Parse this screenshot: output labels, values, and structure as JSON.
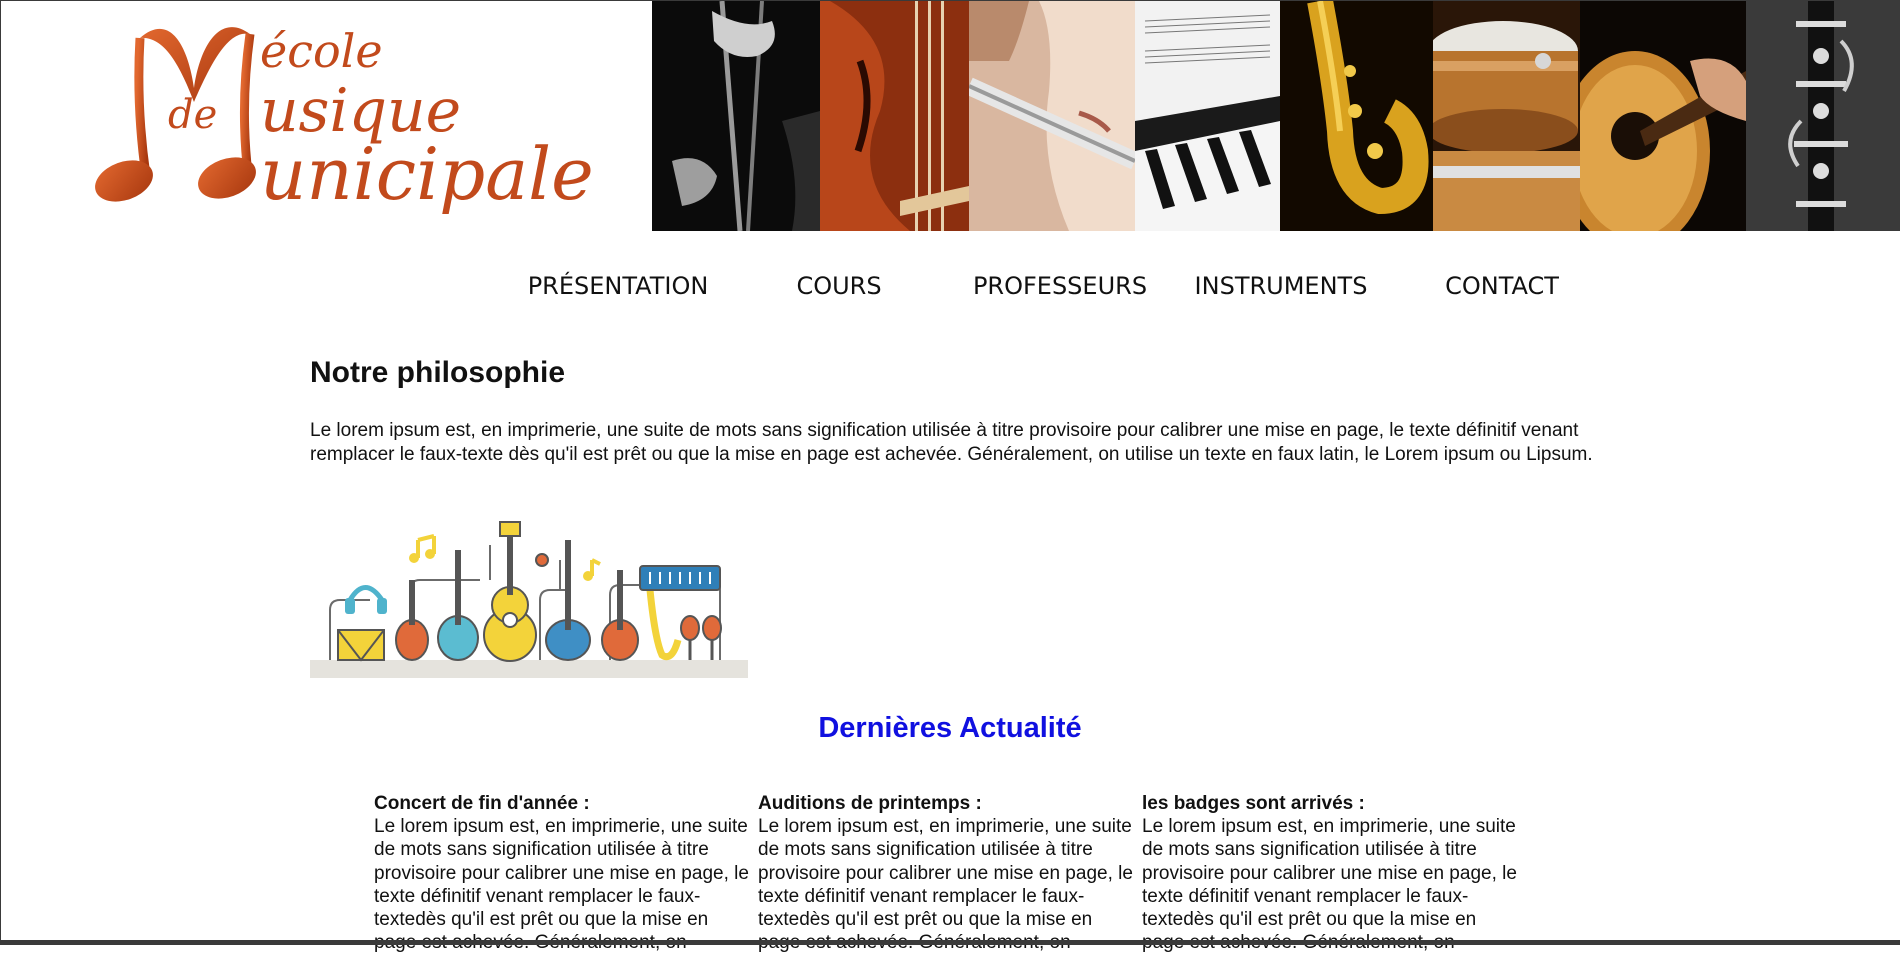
{
  "header": {
    "logo": {
      "word_ecole": "école",
      "word_de": "de",
      "word_usique": "usique",
      "word_unicipale": "unicipale",
      "accent_color": "#c24a1c"
    },
    "banner_photos": [
      "drumsticks",
      "violin",
      "flute",
      "piano",
      "saxophone",
      "drum-kit",
      "guitar",
      "clarinet"
    ]
  },
  "nav": {
    "items": [
      {
        "label": "PRÉSENTATION"
      },
      {
        "label": "COURS"
      },
      {
        "label": "PROFESSEURS"
      },
      {
        "label": "INSTRUMENTS"
      },
      {
        "label": "CONTACT"
      }
    ]
  },
  "main": {
    "title": "Notre philosophie",
    "intro": "Le lorem ipsum est, en imprimerie, une suite de mots sans signification utilisée à titre provisoire pour calibrer une mise en page, le texte définitif venant remplacer le faux-texte dès qu'il est prêt ou que la mise en page est achevée. Généralement, on utilise un texte en faux latin, le Lorem ipsum ou Lipsum.",
    "illustration": "music-instruments-illustration"
  },
  "news": {
    "title": "Dernières Actualité",
    "title_color": "#1010e0",
    "items": [
      {
        "heading": "Concert de fin d'année :",
        "body": "Le lorem ipsum est, en imprimerie, une suite de mots sans signification utilisée à titre provisoire pour calibrer une mise en page, le texte définitif venant remplacer le faux-textedès qu'il est prêt ou que la mise en page est achevée. Généralement, on"
      },
      {
        "heading": "Auditions de printemps :",
        "body": "Le lorem ipsum est, en imprimerie, une suite de mots sans signification utilisée à titre provisoire pour calibrer une mise en page, le texte définitif venant remplacer le faux-textedès qu'il est prêt ou que la mise en page est achevée. Généralement, on"
      },
      {
        "heading": "les badges sont arrivés :",
        "body": "Le lorem ipsum est, en imprimerie, une suite de mots sans signification utilisée à titre provisoire pour calibrer une mise en page, le texte définitif venant remplacer le faux-textedès qu'il est prêt ou que la mise en page est achevée. Généralement, on"
      }
    ]
  }
}
